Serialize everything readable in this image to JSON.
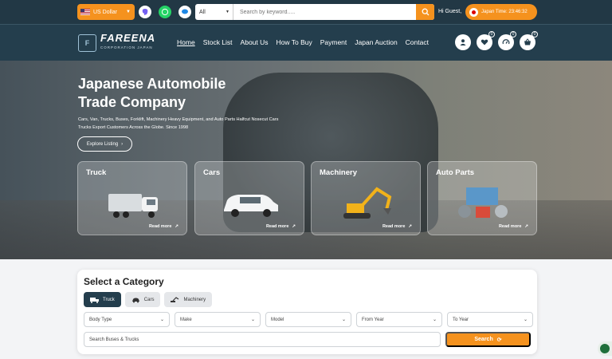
{
  "topbar": {
    "currency": "US Dollar",
    "search_category": "All",
    "search_placeholder": "Search by keyword.....",
    "greeting": "Hi Guest,",
    "japan_time": "Japan Time: 23:46:32"
  },
  "nav": {
    "brand": "FAREENA",
    "brand_sub": "CORPORATION JAPAN",
    "links": [
      "Home",
      "Stock List",
      "About Us",
      "How To Buy",
      "Payment",
      "Japan Auction",
      "Contact"
    ],
    "badges": {
      "favorites": "0",
      "compare": "0",
      "cart": "0"
    }
  },
  "hero": {
    "title": "Japanese Automobile Trade Company",
    "description": "Cars, Van, Trucks, Buses, Forklift, Machinery Heavy Equipment, and Auto Parts Halfcut Nosecut Cars Trucks Export Customers Across the Globe. Since 1998",
    "cta": "Explore Listing",
    "cards": [
      {
        "title": "Truck",
        "link": "Read more"
      },
      {
        "title": "Cars",
        "link": "Read more"
      },
      {
        "title": "Machinery",
        "link": "Read more"
      },
      {
        "title": "Auto Parts",
        "link": "Read more"
      }
    ]
  },
  "category": {
    "title": "Select a Category",
    "tabs": [
      "Truck",
      "Cars",
      "Machinery"
    ],
    "selects": [
      "Body Type",
      "Make",
      "Model",
      "From Year",
      "To Year"
    ],
    "search_placeholder": "Search Buses & Trucks",
    "search_button": "Search"
  },
  "colors": {
    "accent": "#f5921e",
    "navy": "#243e4d"
  }
}
